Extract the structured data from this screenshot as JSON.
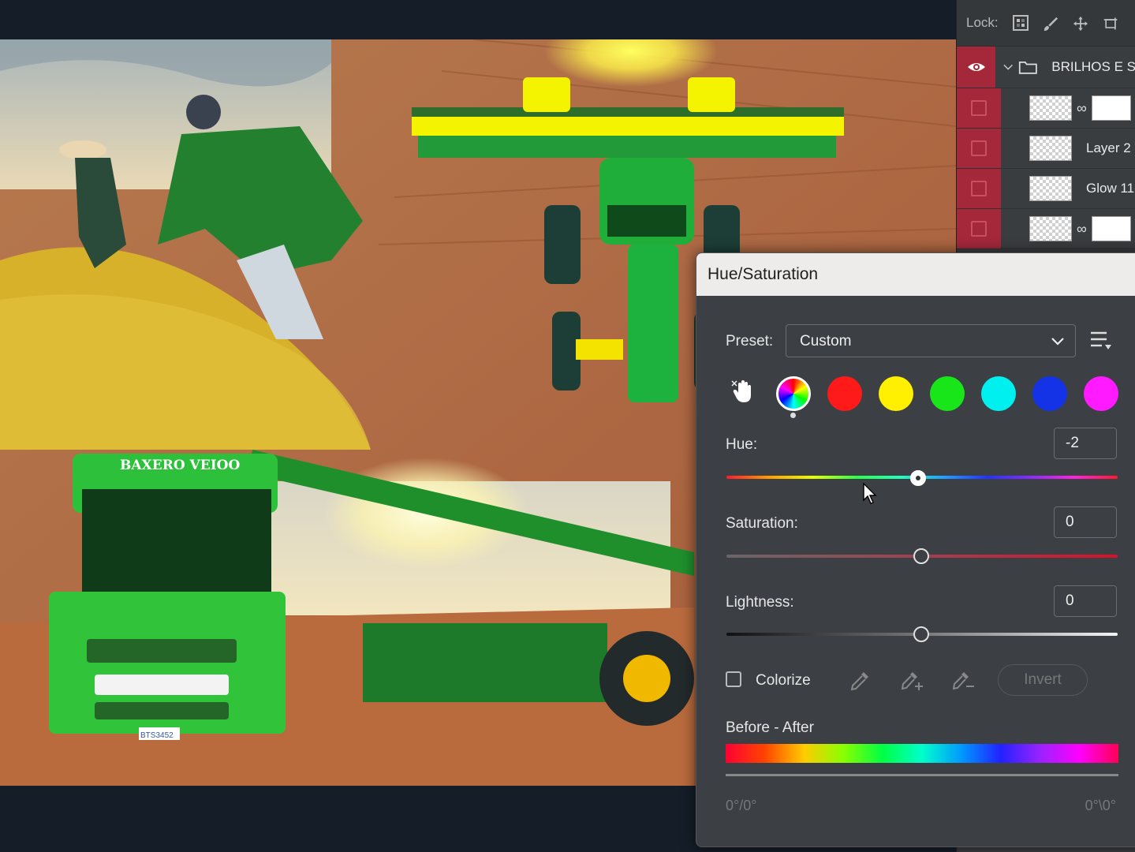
{
  "layers_panel": {
    "lock_label": "Lock:",
    "group_name": "BRILHOS E S",
    "layers": [
      {
        "name": "",
        "has_link": true,
        "has_mask": true
      },
      {
        "name": "Layer 2",
        "has_link": false,
        "has_mask": false
      },
      {
        "name": "Glow 11",
        "has_link": false,
        "has_mask": false
      },
      {
        "name": "",
        "has_link": true,
        "has_mask": true
      }
    ]
  },
  "dialog": {
    "title": "Hue/Saturation",
    "preset_label": "Preset:",
    "preset_value": "Custom",
    "hue_label": "Hue:",
    "hue_value": "-2",
    "saturation_label": "Saturation:",
    "saturation_value": "0",
    "lightness_label": "Lightness:",
    "lightness_value": "0",
    "colorize_label": "Colorize",
    "colorize_checked": false,
    "invert_label": "Invert",
    "before_after_label": "Before - After",
    "range_left": "0°/0°",
    "range_right": "0°\\0°",
    "swatch_colors": [
      "#ff1a1a",
      "#ffef00",
      "#19e619",
      "#00f0f0",
      "#1433e6",
      "#ff1aff"
    ]
  },
  "canvas_text": {
    "truck_brand": "BAXERO VEIOO",
    "plate": "BTS3452"
  },
  "icons": [
    "lock-transparent-icon",
    "lock-brush-icon",
    "lock-move-icon",
    "lock-artboard-icon",
    "eye-icon",
    "chevron-down-icon",
    "folder-icon",
    "link-icon",
    "targeted-adjustment-hand-icon",
    "master-color-icon",
    "chevron-down-icon",
    "preset-menu-icon",
    "eyedropper-icon",
    "eyedropper-add-icon",
    "eyedropper-subtract-icon",
    "mouse-cursor-icon"
  ]
}
